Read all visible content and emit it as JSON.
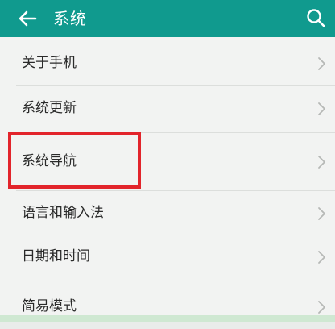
{
  "header": {
    "title": "系统",
    "back_icon": "arrow-left-icon",
    "search_icon": "search-icon",
    "background_color": "#109a8e"
  },
  "settings": {
    "items": [
      {
        "label": "关于手机"
      },
      {
        "label": "系统更新"
      },
      {
        "label": "系统导航",
        "highlighted": true
      },
      {
        "label": "语言和输入法"
      },
      {
        "label": "日期和时间"
      },
      {
        "label": "简易模式"
      }
    ],
    "chevron_icon": "chevron-right-icon",
    "highlight_color": "#e2242b"
  }
}
